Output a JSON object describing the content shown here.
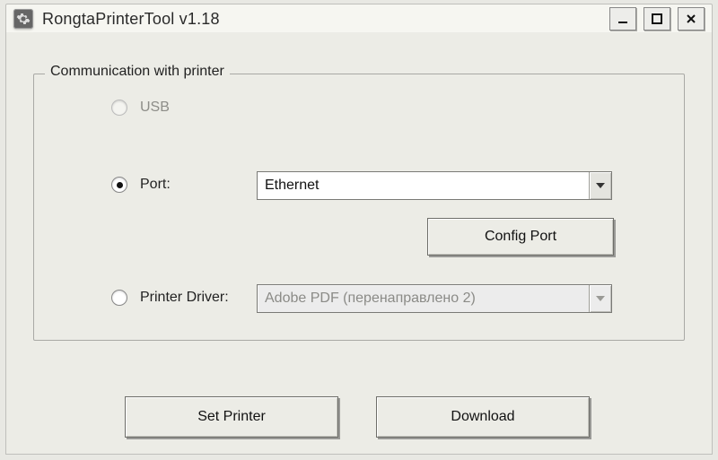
{
  "window": {
    "title": "RongtaPrinterTool v1.18"
  },
  "group": {
    "legend": "Communication with printer",
    "options": {
      "usb": {
        "label": "USB",
        "enabled": false,
        "selected": false
      },
      "port": {
        "label": "Port:",
        "selected": true,
        "value": "Ethernet"
      },
      "printer_driver": {
        "label": "Printer Driver:",
        "selected": false,
        "enabled": false,
        "value": "Adobe PDF (перенаправлено 2)"
      }
    },
    "config_port_button": "Config Port"
  },
  "buttons": {
    "set_printer": "Set Printer",
    "download": "Download"
  }
}
